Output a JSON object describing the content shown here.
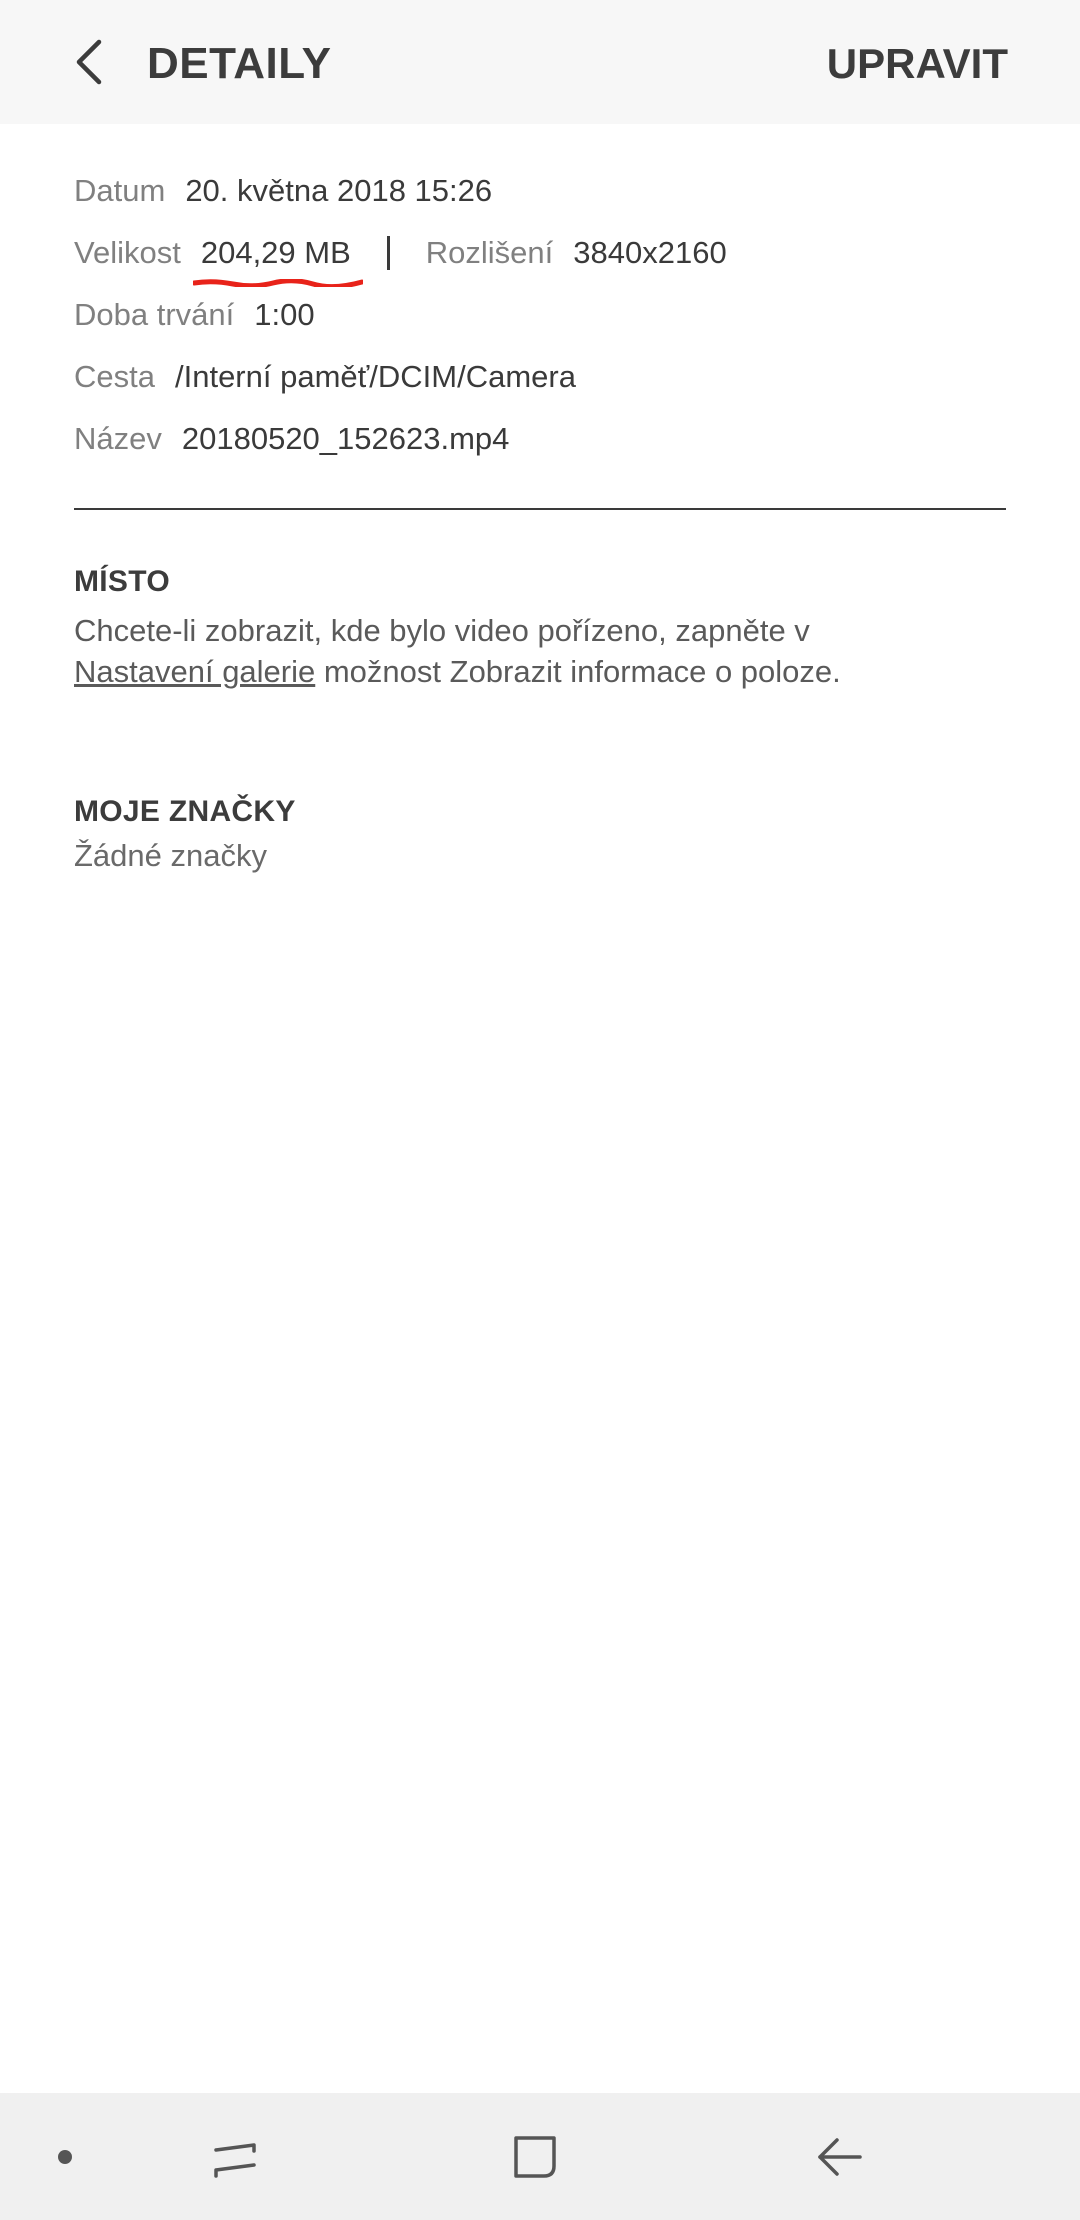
{
  "header": {
    "title": "DETAILY",
    "edit_label": "UPRAVIT"
  },
  "details": {
    "date_label": "Datum",
    "date_value": "20. května 2018 15:26",
    "size_label": "Velikost",
    "size_value": "204,29 MB",
    "resolution_label": "Rozlišení",
    "resolution_value": "3840x2160",
    "duration_label": "Doba trvání",
    "duration_value": "1:00",
    "path_label": "Cesta",
    "path_value": "/Interní paměť/DCIM/Camera",
    "name_label": "Název",
    "name_value": "20180520_152623.mp4"
  },
  "location": {
    "title": "MÍSTO",
    "text_before": "Chcete-li zobrazit, kde bylo video pořízeno, zapněte v",
    "link": "Nastavení galerie",
    "text_after": " možnost Zobrazit informace o poloze."
  },
  "tags": {
    "title": "MOJE ZNAČKY",
    "value": "Žádné značky"
  },
  "colors": {
    "header_bg": "#f7f7f7",
    "annotation_red": "#e8231a",
    "navbar_bg": "#f0f0f0"
  },
  "navbar": {
    "items": [
      "dot-icon",
      "recent-apps-icon",
      "home-icon",
      "back-arrow-icon"
    ]
  }
}
